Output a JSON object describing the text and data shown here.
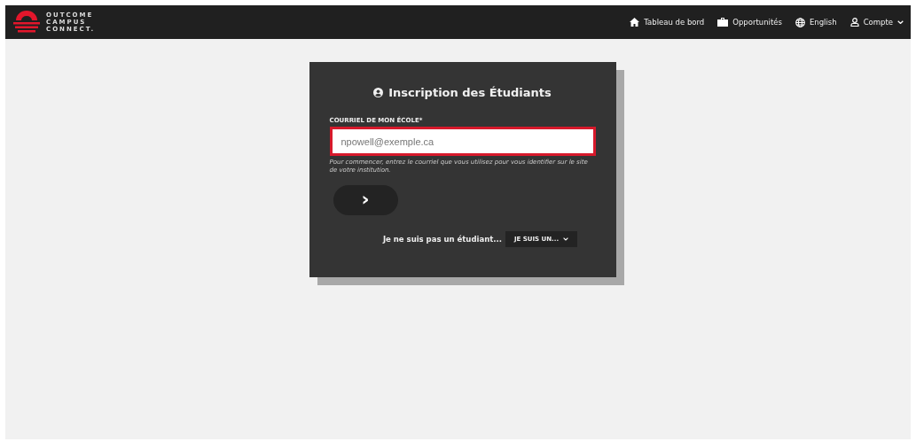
{
  "logo": {
    "lines": [
      "OUTCOME",
      "CAMPUS",
      "CONNECT."
    ]
  },
  "nav": [
    {
      "kind": "home",
      "label": "Tableau de bord"
    },
    {
      "kind": "briefcase",
      "label": "Opportunités"
    },
    {
      "kind": "globe",
      "label": "English"
    },
    {
      "kind": "user",
      "label": "Compte",
      "dropdown": true
    }
  ],
  "card": {
    "title": "Inscription des Étudiants",
    "field_label": "COURRIEL DE MON ÉCOLE*",
    "placeholder": "npowell@exemple.ca",
    "highlighted": true,
    "help": "Pour commencer, entrez le courriel que vous utilisez pour vous identifier sur le site de votre institution.",
    "next_button": "›",
    "other_text": "Je ne suis pas un étudiant...",
    "other_select": "JE SUIS UN..."
  }
}
